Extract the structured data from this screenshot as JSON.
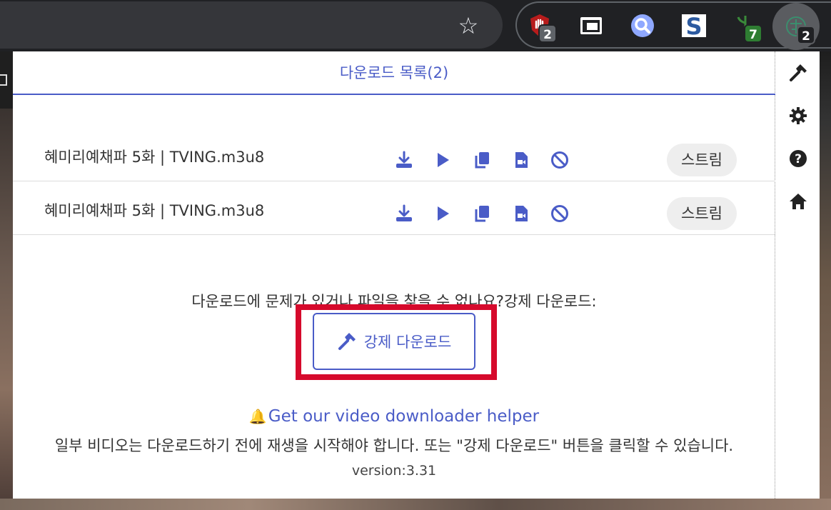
{
  "browser": {
    "extensions": [
      {
        "name": "ublock-icon",
        "badge": "2",
        "badge_color": "#5f6368"
      },
      {
        "name": "picture-in-picture-icon",
        "badge": ""
      },
      {
        "name": "search-lens-icon",
        "badge": ""
      },
      {
        "name": "s-extension-icon",
        "badge": ""
      },
      {
        "name": "plant-extension-icon",
        "badge": "7",
        "badge_color": "#2e7d32"
      },
      {
        "name": "video-downloader-icon",
        "badge": "2",
        "badge_color": "#202124"
      }
    ]
  },
  "popup": {
    "header_title": "다운로드 목록(2)",
    "downloads": [
      {
        "filename": "혜미리예채파 5화 | TVING.m3u8",
        "stream_label": "스트림"
      },
      {
        "filename": "혜미리예채파 5화 | TVING.m3u8",
        "stream_label": "스트림"
      }
    ],
    "force_prompt": "다운로드에 문제가 있거나 파일을 찾을 수 없나요?강제 다운로드:",
    "force_button_label": "강제 다운로드",
    "helper_link": "Get our video downloader helper",
    "note": "일부 비디오는 다운로드하기 전에 재생을 시작해야 합니다. 또는 \"강제 다운로드\" 버튼을 클릭할 수 있습니다.",
    "version": "version:3.31"
  },
  "colors": {
    "accent": "#4a5cc7",
    "highlight": "#d60a2c"
  }
}
